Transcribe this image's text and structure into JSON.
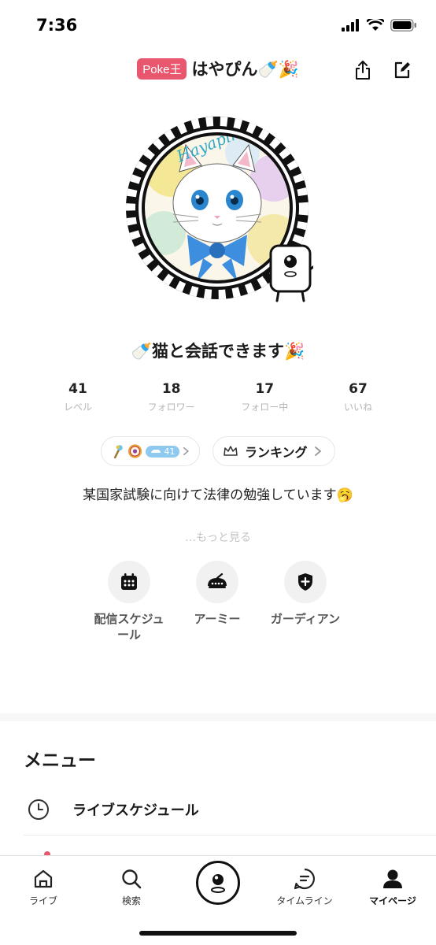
{
  "status_bar": {
    "time": "7:36"
  },
  "header": {
    "badge": "Poke王",
    "user_name": "はやぴん🍼🎉"
  },
  "avatar": {
    "watermark": "Hayapin Sanso"
  },
  "profile": {
    "headline": "🍼猫と会話できます🎉",
    "stats": [
      {
        "value": "41",
        "label": "レベル"
      },
      {
        "value": "18",
        "label": "フォロワー"
      },
      {
        "value": "17",
        "label": "フォロー中"
      },
      {
        "value": "67",
        "label": "いいね"
      }
    ],
    "badge_count": "41",
    "ranking_label": "ランキング",
    "description": "某国家試験に向けて法律の勉強しています🥱",
    "more_label": "…もっと見る"
  },
  "quick_actions": [
    {
      "label": "配信スケジュール",
      "icon": "calendar-icon"
    },
    {
      "label": "アーミー",
      "icon": "army-icon"
    },
    {
      "label": "ガーディアン",
      "icon": "shield-icon"
    }
  ],
  "menu": {
    "title": "メニュー",
    "items": [
      {
        "label": "ライブスケジュール",
        "icon": "clock-icon"
      }
    ]
  },
  "tabbar": {
    "items": [
      {
        "label": "ライブ",
        "icon": "home-icon"
      },
      {
        "label": "検索",
        "icon": "search-icon"
      },
      {
        "label": "",
        "icon": "mascot-icon"
      },
      {
        "label": "タイムライン",
        "icon": "timeline-icon"
      },
      {
        "label": "マイページ",
        "icon": "person-icon"
      }
    ],
    "active": "マイページ"
  },
  "colors": {
    "badge": "#e8576e",
    "notification_dot": "#e8576e",
    "count_badge": "#8ec9ef"
  }
}
